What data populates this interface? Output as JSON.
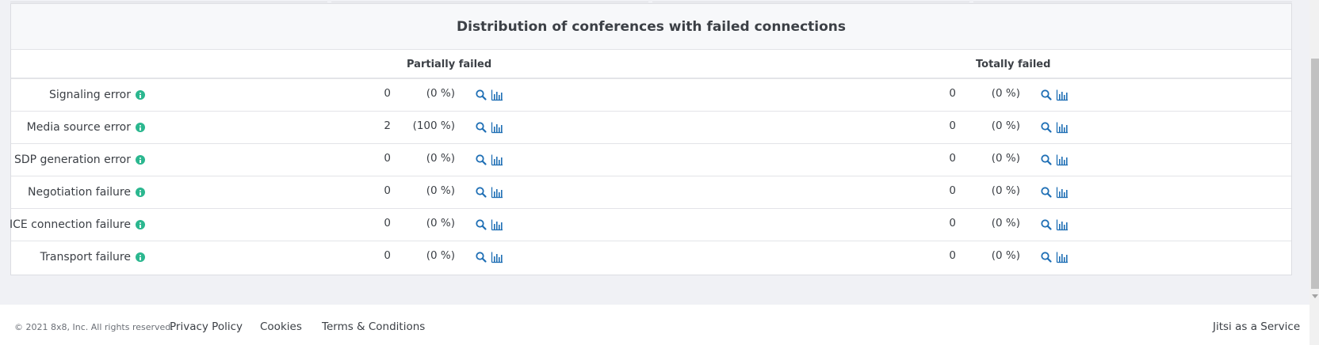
{
  "panel": {
    "title": "Distribution of conferences with failed connections",
    "columns": [
      "Partially failed",
      "Totally failed"
    ]
  },
  "rows": [
    {
      "label": "Signaling error",
      "partial": {
        "count": "0",
        "pct": "(0 %)"
      },
      "total": {
        "count": "0",
        "pct": "(0 %)"
      }
    },
    {
      "label": "Media source error",
      "partial": {
        "count": "2",
        "pct": "(100 %)"
      },
      "total": {
        "count": "0",
        "pct": "(0 %)"
      }
    },
    {
      "label": "SDP generation error",
      "partial": {
        "count": "0",
        "pct": "(0 %)"
      },
      "total": {
        "count": "0",
        "pct": "(0 %)"
      }
    },
    {
      "label": "Negotiation failure",
      "partial": {
        "count": "0",
        "pct": "(0 %)"
      },
      "total": {
        "count": "0",
        "pct": "(0 %)"
      }
    },
    {
      "label": "ICE connection failure",
      "partial": {
        "count": "0",
        "pct": "(0 %)"
      },
      "total": {
        "count": "0",
        "pct": "(0 %)"
      }
    },
    {
      "label": "Transport failure",
      "partial": {
        "count": "0",
        "pct": "(0 %)"
      },
      "total": {
        "count": "0",
        "pct": "(0 %)"
      }
    }
  ],
  "icons": {
    "info": "info-icon",
    "search": "search-icon",
    "chart": "bar-chart-icon"
  },
  "colors": {
    "info": "#2bb78f",
    "action_icon": "#1f6fb5",
    "background": "#f0f1f5"
  },
  "footer": {
    "copyright": "© 2021 8x8, Inc. All rights reserved.",
    "links": [
      "Privacy Policy",
      "Cookies",
      "Terms & Conditions"
    ],
    "right_link": "Jitsi as a Service"
  }
}
